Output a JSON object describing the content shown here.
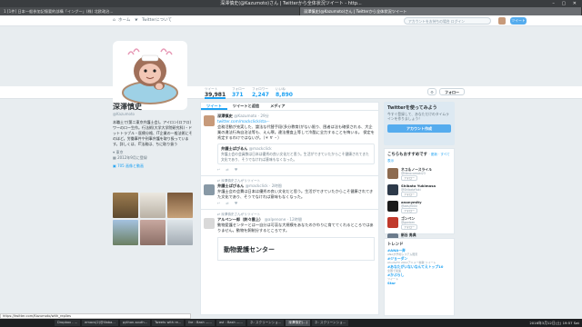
{
  "window": {
    "title": "深澤慎史(@Kazumoto)さん | Twitterから全体状況ツイート - http...",
    "controls": "– ▢ ✕"
  },
  "browser_tabs": [
    {
      "label": "1 [1件] 日本一般参加記憶要約部構「イングー」(株) 北欧政治..."
    },
    {
      "label": "深澤慎史(@Kazumoto)さん | Twitterから全体状況ツイート",
      "active": true
    }
  ],
  "nav": {
    "home": "ホーム",
    "about": "Twitterについて",
    "search_placeholder": "アカウントをお持ちの場合 ログイン",
    "tweet_button": "ツイート"
  },
  "profile": {
    "name": "深澤慎史",
    "handle": "@Kazumoto",
    "bio": "本職土で(第二東京弁護士会)。アイロン(ロフロ)ワーのロー生作。行法術(大学大学院研究科)・ドットトラブル・医療分格、IT企業の一般法術にそのほど。労働事件や刑事弁護を取り扱っています。詳しくは、IT法務は、ちに取り扱う",
    "location": "東京",
    "joined": "2012年9月に登録",
    "media_label": "705 画像と動画"
  },
  "stats": [
    {
      "label": "ツイート",
      "value": "39,981",
      "active": true
    },
    {
      "label": "フォロー",
      "value": "371"
    },
    {
      "label": "フォロワー",
      "value": "2,247"
    },
    {
      "label": "いいね",
      "value": "8,890"
    }
  ],
  "follow_button": "フォロー",
  "timeline": {
    "tabs": [
      "ツイート",
      "ツイートと返信",
      "メディア"
    ],
    "tweets": [
      {
        "retweet_note": "",
        "name": "深澤慎史",
        "handle": "@Kazumoto · 29分",
        "link": "twitter.com/mackclick/sta···",
        "text": "会務活動が充実した、論法な代替手段(多分教育)がない限り、困者は法も確保される、大企業の違法行為自治法等も、えん罪。違法捜査上等して冷酷に全力することを悔いる。 保定を肯定するわけではないが。（＊ ∀ ・）",
        "quote_name": "弁護士ぱぴるん",
        "quote_handle": "@mackclick",
        "quote_text": "弁護士会の会員数は日本は優秀の良い文化だと思う。生活ができていたからこそ健康されてきた文化であり、そうでなければ意味もなくなった。"
      },
      {
        "retweet_note": "深澤慎史さんがリツイート",
        "name": "弁護士ぱぴるん",
        "handle": "@mackclick · 2時間",
        "link": "",
        "text": "弁護士会の会費は日本は優秀の良い文化だと思う。生活ができていたからこそ健康されてきた文化であり、そうでなければ意味もなくなった。",
        "quote_name": "",
        "quote_handle": "",
        "quote_text": ""
      },
      {
        "retweet_note": "深澤慎史さんがリツイート",
        "name": "アルペン一郎（鈴々雲上）",
        "handle": "@alpenone · 12時間",
        "link": "",
        "text": "動物愛護センターとは～自分は可哀な大規模をあなたのかわりに育ててくれるところではありません。動物を飼制分するところです。",
        "quote_name": "",
        "quote_handle": "",
        "quote_text": "",
        "card_title": "動物愛護センター"
      }
    ]
  },
  "join": {
    "title": "Twitterを使ってみよう",
    "text": "今すぐ登録して、あなただけのタイムラインを作りましょう！",
    "button": "アカウント作成"
  },
  "who_to_follow": {
    "title": "こちらもおすすめです",
    "more": "· 更新 · すべて表示",
    "users": [
      {
        "name": "ネコ＆ノースライル",
        "handle": "@Necocomaki23",
        "button": "フォロー",
        "color": "#8d6b50"
      },
      {
        "name": "Shibata Yukimasa",
        "handle": "@ShibataYuki",
        "button": "フォロー",
        "color": "#2d3a4a"
      },
      {
        "name": "anonymity",
        "handle": "@adsj9000",
        "button": "フォロー",
        "color": "#1b1b1b"
      },
      {
        "name": "ゴンベン",
        "handle": "@gonben",
        "button": "フォロー",
        "color": "#c0392b"
      },
      {
        "name": "新谷 勇典",
        "handle": "@yasukata",
        "button": "フォロー",
        "color": "#6b7b8c"
      }
    ]
  },
  "trends": {
    "title": "トレンド",
    "items": [
      {
        "tag": "#ANA一斉",
        "sub": "ANAが予約システム障害"
      },
      {
        "tag": "#ジョーダン",
        "sub": "AhurtaTV 2012アニメー新歌 ツイート"
      },
      {
        "tag": "#あなたがいないなんてえトップ10",
        "sub": "全国で最速"
      },
      {
        "tag": "#かぶらし",
        "sub": "ツイート"
      },
      {
        "tag": "Star",
        "sub": ""
      }
    ]
  },
  "status_url": "https://twitter.com/Kazumoto/with_replies",
  "taskbar": {
    "items": [
      {
        "label": "Dropbox - ..."
      },
      {
        "label": "emacs(2)@illaba..."
      },
      {
        "label": "python-south..."
      },
      {
        "label": "Tweets with re..."
      },
      {
        "label": "Ike : Bash —..."
      },
      {
        "label": "ast : Bash —..."
      },
      {
        "label": "ネ: スクリーンショ..."
      },
      {
        "label": "深澤慎史(...)",
        "active": true
      },
      {
        "label": "ネ: スクリーンショ..."
      }
    ],
    "clock": "2016年3月12日(土) 19:57 Sat"
  },
  "colors": {
    "accent": "#1da1f2",
    "join_button": "#55acee"
  },
  "icons": [
    "home-icon",
    "bird-icon",
    "location-icon",
    "calendar-icon",
    "photo-icon",
    "reply-icon",
    "retweet-icon",
    "like-icon",
    "gear-icon"
  ]
}
